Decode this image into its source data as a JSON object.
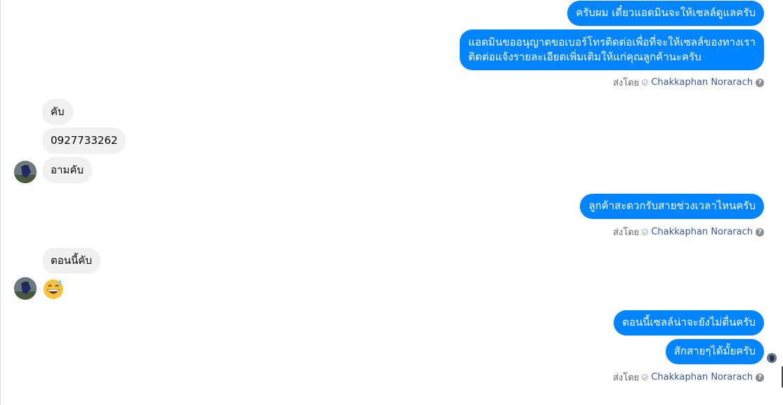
{
  "messages": {
    "out_1": "ครับผม เดี๋ยวแอดมินจะให้เซลล์ดูแลครับ",
    "out_2_line1": "แอดมินขออนุญาตขอเบอร์โทรติดต่อเพื่อที่จะให้เซลล์ของทางเรา",
    "out_2_line2": "ติดต่อแจ้งรายละเอียดเพิ่มเติมให้แก่คุณลูกค้านะครับ",
    "in_1": "คับ",
    "in_2": "0927733262",
    "in_3": "อามคับ",
    "out_3": "ลูกค้าสะดวกรับสายช่วงเวลาไหนครับ",
    "in_4": "ตอนนี้คับ",
    "out_4": "ตอนนี้เซลล์น่าจะยังไม่ตื่นครับ",
    "out_5": "สักสายๆได้มั้ยครับ"
  },
  "sent_by": {
    "label": "ส่งโดย",
    "name": "Chakkaphan Norarach",
    "help": "?"
  },
  "icons": {
    "emoji": "grinning-face-with-sweat",
    "check": "check-circle-icon",
    "help": "question-icon"
  },
  "colors": {
    "outgoing_bubble": "#0084ff",
    "incoming_bubble": "#f0f0f0",
    "sender_name": "#385898"
  }
}
